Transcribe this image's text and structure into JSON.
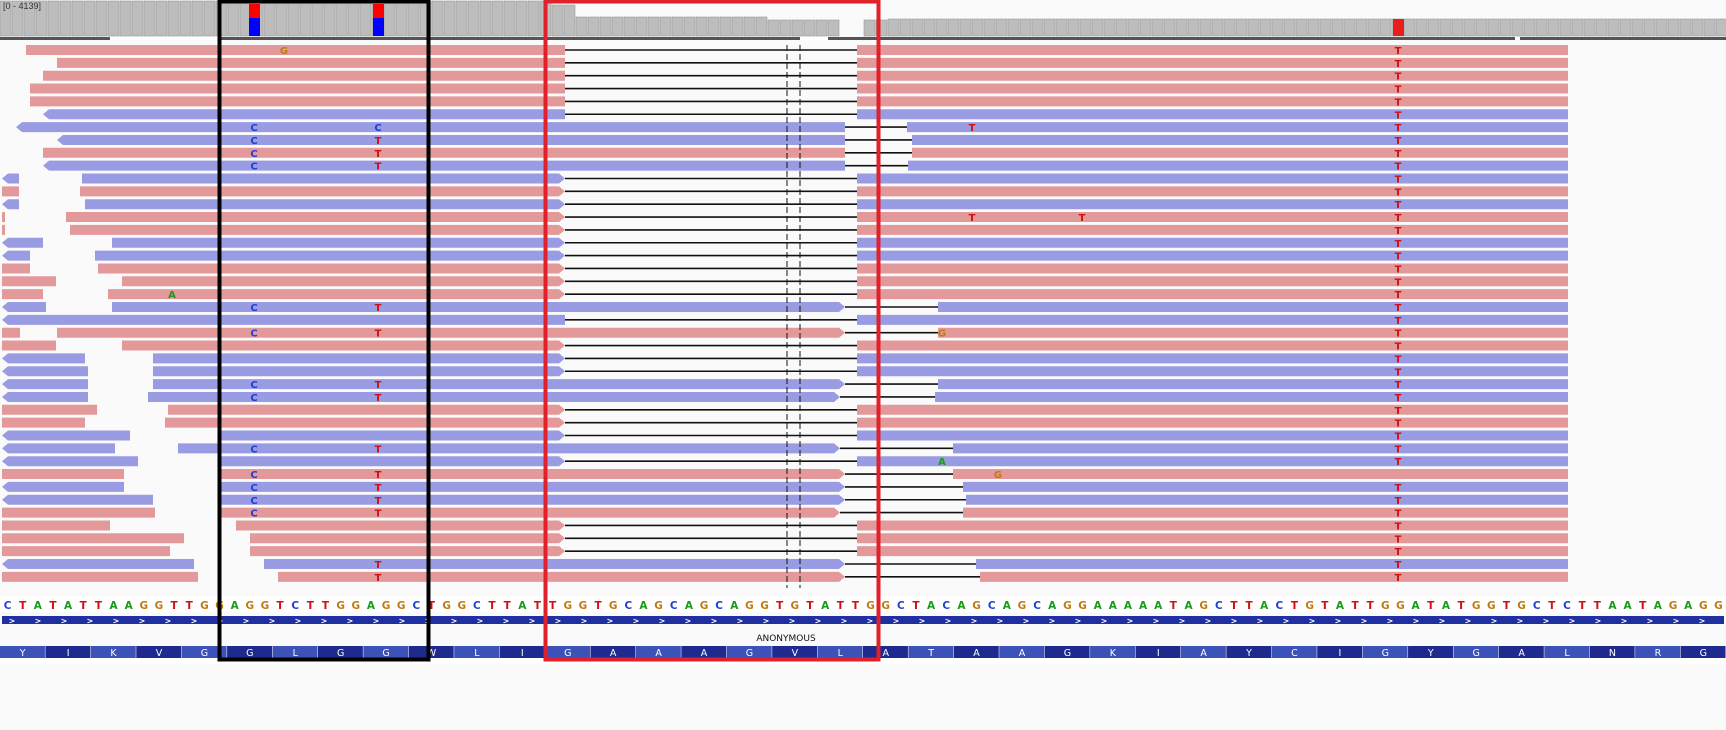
{
  "coverage": {
    "range_label": "[0 - 4139]",
    "mismatch_colors": {
      "top": "#ff0000",
      "bottom": "#0000ff"
    }
  },
  "colors": {
    "forward_read": "#e3999a",
    "reverse_read": "#999be3",
    "coverage_bar": "#bdbdbd",
    "highlight_black": "#000000",
    "highlight_red": "#e0202a"
  },
  "reads": {
    "rows": [
      {
        "strand": "+",
        "segments": [
          [
            26,
            565
          ],
          [
            857,
            1568
          ]
        ],
        "mismatches": [
          {
            "pos": 284,
            "base": "G"
          },
          {
            "pos": 1398,
            "base": "T"
          }
        ]
      },
      {
        "strand": "+",
        "segments": [
          [
            57,
            565
          ],
          [
            857,
            1568
          ]
        ],
        "mismatches": [
          {
            "pos": 1398,
            "base": "T"
          }
        ]
      },
      {
        "strand": "+",
        "segments": [
          [
            43,
            565
          ],
          [
            857,
            1568
          ]
        ],
        "mismatches": [
          {
            "pos": 1398,
            "base": "T"
          }
        ]
      },
      {
        "strand": "+",
        "segments": [
          [
            30,
            565
          ],
          [
            857,
            1568
          ]
        ],
        "mismatches": [
          {
            "pos": 1398,
            "base": "T"
          }
        ]
      },
      {
        "strand": "+",
        "segments": [
          [
            30,
            565
          ],
          [
            857,
            1568
          ]
        ],
        "mismatches": [
          {
            "pos": 1398,
            "base": "T"
          }
        ]
      },
      {
        "strand": "-",
        "segments": [
          [
            43,
            565
          ],
          [
            857,
            1568
          ]
        ],
        "mismatches": [
          {
            "pos": 1398,
            "base": "T"
          }
        ]
      },
      {
        "strand": "-",
        "segments": [
          [
            16,
            845
          ],
          [
            907,
            1568
          ]
        ],
        "mismatches": [
          {
            "pos": 254,
            "base": "C"
          },
          {
            "pos": 378,
            "base": "C"
          },
          {
            "pos": 972,
            "base": "T"
          },
          {
            "pos": 1398,
            "base": "T"
          }
        ]
      },
      {
        "strand": "-",
        "segments": [
          [
            57,
            845
          ],
          [
            912,
            1568
          ]
        ],
        "mismatches": [
          {
            "pos": 254,
            "base": "C"
          },
          {
            "pos": 378,
            "base": "T"
          },
          {
            "pos": 1398,
            "base": "T"
          }
        ]
      },
      {
        "strand": "+",
        "segments": [
          [
            43,
            845
          ],
          [
            912,
            1568
          ]
        ],
        "mismatches": [
          {
            "pos": 254,
            "base": "C"
          },
          {
            "pos": 378,
            "base": "T"
          },
          {
            "pos": 1398,
            "base": "T"
          }
        ]
      },
      {
        "strand": "-",
        "segments": [
          [
            43,
            845
          ],
          [
            908,
            1568
          ]
        ],
        "mismatches": [
          {
            "pos": 254,
            "base": "C"
          },
          {
            "pos": 378,
            "base": "T"
          },
          {
            "pos": 1398,
            "base": "T"
          }
        ]
      },
      {
        "strand": "-",
        "segments": [
          [
            2,
            19
          ],
          [
            82,
            565
          ],
          [
            857,
            1568
          ]
        ],
        "mismatches": [
          {
            "pos": 1398,
            "base": "T"
          }
        ]
      },
      {
        "strand": "+",
        "segments": [
          [
            2,
            19
          ],
          [
            80,
            565
          ],
          [
            857,
            1568
          ]
        ],
        "mismatches": [
          {
            "pos": 1398,
            "base": "T"
          }
        ]
      },
      {
        "strand": "-",
        "segments": [
          [
            2,
            19
          ],
          [
            85,
            565
          ],
          [
            857,
            1568
          ]
        ],
        "mismatches": [
          {
            "pos": 1398,
            "base": "T"
          }
        ]
      },
      {
        "strand": "+",
        "segments": [
          [
            2,
            5
          ],
          [
            66,
            565
          ],
          [
            857,
            1568
          ]
        ],
        "mismatches": [
          {
            "pos": 972,
            "base": "T"
          },
          {
            "pos": 1082,
            "base": "T"
          },
          {
            "pos": 1398,
            "base": "T"
          }
        ]
      },
      {
        "strand": "+",
        "segments": [
          [
            2,
            5
          ],
          [
            70,
            565
          ],
          [
            857,
            1568
          ]
        ],
        "mismatches": [
          {
            "pos": 1398,
            "base": "T"
          }
        ]
      },
      {
        "strand": "-",
        "segments": [
          [
            2,
            43
          ],
          [
            112,
            565
          ],
          [
            857,
            1568
          ]
        ],
        "mismatches": [
          {
            "pos": 1398,
            "base": "T"
          }
        ]
      },
      {
        "strand": "-",
        "segments": [
          [
            2,
            30
          ],
          [
            95,
            565
          ],
          [
            857,
            1568
          ]
        ],
        "mismatches": [
          {
            "pos": 1398,
            "base": "T"
          }
        ]
      },
      {
        "strand": "+",
        "segments": [
          [
            2,
            30
          ],
          [
            98,
            565
          ],
          [
            857,
            1568
          ]
        ],
        "mismatches": [
          {
            "pos": 1398,
            "base": "T"
          }
        ]
      },
      {
        "strand": "+",
        "segments": [
          [
            2,
            56
          ],
          [
            122,
            565
          ],
          [
            857,
            1568
          ]
        ],
        "mismatches": [
          {
            "pos": 1398,
            "base": "T"
          }
        ]
      },
      {
        "strand": "+",
        "segments": [
          [
            2,
            43
          ],
          [
            108,
            565
          ],
          [
            857,
            1568
          ]
        ],
        "mismatches": [
          {
            "pos": 172,
            "base": "A"
          },
          {
            "pos": 1398,
            "base": "T"
          }
        ]
      },
      {
        "strand": "-",
        "segments": [
          [
            2,
            46
          ],
          [
            112,
            845
          ],
          [
            938,
            1568
          ]
        ],
        "mismatches": [
          {
            "pos": 254,
            "base": "C"
          },
          {
            "pos": 378,
            "base": "T"
          },
          {
            "pos": 1398,
            "base": "T"
          }
        ]
      },
      {
        "strand": "-",
        "segments": [
          [
            2,
            565
          ],
          [
            857,
            1568
          ]
        ],
        "mismatches": [
          {
            "pos": 1398,
            "base": "T"
          }
        ]
      },
      {
        "strand": "+",
        "segments": [
          [
            2,
            20
          ],
          [
            57,
            845
          ],
          [
            938,
            1568
          ]
        ],
        "mismatches": [
          {
            "pos": 254,
            "base": "C"
          },
          {
            "pos": 378,
            "base": "T"
          },
          {
            "pos": 942,
            "base": "G"
          },
          {
            "pos": 1398,
            "base": "T"
          }
        ]
      },
      {
        "strand": "+",
        "segments": [
          [
            2,
            56
          ],
          [
            122,
            565
          ],
          [
            857,
            1568
          ]
        ],
        "mismatches": [
          {
            "pos": 1398,
            "base": "T"
          }
        ]
      },
      {
        "strand": "-",
        "segments": [
          [
            2,
            85
          ],
          [
            153,
            565
          ],
          [
            857,
            1568
          ]
        ],
        "mismatches": [
          {
            "pos": 1398,
            "base": "T"
          }
        ]
      },
      {
        "strand": "-",
        "segments": [
          [
            2,
            88
          ],
          [
            153,
            565
          ],
          [
            857,
            1568
          ]
        ],
        "mismatches": [
          {
            "pos": 1398,
            "base": "T"
          }
        ]
      },
      {
        "strand": "-",
        "segments": [
          [
            2,
            88
          ],
          [
            153,
            845
          ],
          [
            938,
            1568
          ]
        ],
        "mismatches": [
          {
            "pos": 254,
            "base": "C"
          },
          {
            "pos": 378,
            "base": "T"
          },
          {
            "pos": 1398,
            "base": "T"
          }
        ]
      },
      {
        "strand": "-",
        "segments": [
          [
            2,
            88
          ],
          [
            148,
            840
          ],
          [
            935,
            1568
          ]
        ],
        "mismatches": [
          {
            "pos": 254,
            "base": "C"
          },
          {
            "pos": 378,
            "base": "T"
          },
          {
            "pos": 1398,
            "base": "T"
          }
        ]
      },
      {
        "strand": "+",
        "segments": [
          [
            2,
            97
          ],
          [
            168,
            565
          ],
          [
            857,
            1568
          ]
        ],
        "mismatches": [
          {
            "pos": 1398,
            "base": "T"
          }
        ]
      },
      {
        "strand": "+",
        "segments": [
          [
            2,
            85
          ],
          [
            165,
            565
          ],
          [
            857,
            1568
          ]
        ],
        "mismatches": [
          {
            "pos": 1398,
            "base": "T"
          }
        ]
      },
      {
        "strand": "-",
        "segments": [
          [
            2,
            130
          ],
          [
            218,
            565
          ],
          [
            857,
            1568
          ]
        ],
        "mismatches": [
          {
            "pos": 1398,
            "base": "T"
          }
        ]
      },
      {
        "strand": "-",
        "segments": [
          [
            2,
            115
          ],
          [
            178,
            840
          ],
          [
            953,
            1568
          ]
        ],
        "mismatches": [
          {
            "pos": 254,
            "base": "C"
          },
          {
            "pos": 378,
            "base": "T"
          },
          {
            "pos": 1398,
            "base": "T"
          }
        ]
      },
      {
        "strand": "-",
        "segments": [
          [
            2,
            138
          ],
          [
            218,
            565
          ],
          [
            857,
            1568
          ]
        ],
        "mismatches": [
          {
            "pos": 942,
            "base": "A"
          },
          {
            "pos": 1398,
            "base": "T"
          }
        ]
      },
      {
        "strand": "+",
        "segments": [
          [
            2,
            124
          ],
          [
            220,
            845
          ],
          [
            953,
            1568
          ]
        ],
        "mismatches": [
          {
            "pos": 254,
            "base": "C"
          },
          {
            "pos": 378,
            "base": "T"
          },
          {
            "pos": 998,
            "base": "G"
          }
        ]
      },
      {
        "strand": "-",
        "segments": [
          [
            2,
            124
          ],
          [
            220,
            845
          ],
          [
            963,
            1568
          ]
        ],
        "mismatches": [
          {
            "pos": 254,
            "base": "C"
          },
          {
            "pos": 378,
            "base": "T"
          },
          {
            "pos": 1398,
            "base": "T"
          }
        ]
      },
      {
        "strand": "-",
        "segments": [
          [
            2,
            153
          ],
          [
            220,
            845
          ],
          [
            966,
            1568
          ]
        ],
        "mismatches": [
          {
            "pos": 254,
            "base": "C"
          },
          {
            "pos": 378,
            "base": "T"
          },
          {
            "pos": 1398,
            "base": "T"
          }
        ]
      },
      {
        "strand": "+",
        "segments": [
          [
            2,
            155
          ],
          [
            220,
            840
          ],
          [
            963,
            1568
          ]
        ],
        "mismatches": [
          {
            "pos": 254,
            "base": "C"
          },
          {
            "pos": 378,
            "base": "T"
          },
          {
            "pos": 1398,
            "base": "T"
          }
        ]
      },
      {
        "strand": "+",
        "segments": [
          [
            2,
            110
          ],
          [
            236,
            565
          ],
          [
            857,
            1568
          ]
        ],
        "mismatches": [
          {
            "pos": 1398,
            "base": "T"
          }
        ]
      },
      {
        "strand": "+",
        "segments": [
          [
            2,
            184
          ],
          [
            250,
            565
          ],
          [
            857,
            1568
          ]
        ],
        "mismatches": [
          {
            "pos": 1398,
            "base": "T"
          }
        ]
      },
      {
        "strand": "+",
        "segments": [
          [
            2,
            170
          ],
          [
            250,
            565
          ],
          [
            857,
            1568
          ]
        ],
        "mismatches": [
          {
            "pos": 1398,
            "base": "T"
          }
        ]
      },
      {
        "strand": "-",
        "segments": [
          [
            2,
            194
          ],
          [
            264,
            845
          ],
          [
            976,
            1568
          ]
        ],
        "mismatches": [
          {
            "pos": 378,
            "base": "T"
          },
          {
            "pos": 1398,
            "base": "T"
          }
        ]
      },
      {
        "strand": "+",
        "segments": [
          [
            2,
            198
          ],
          [
            278,
            845
          ],
          [
            980,
            1568
          ]
        ],
        "mismatches": [
          {
            "pos": 378,
            "base": "T"
          },
          {
            "pos": 1398,
            "base": "T"
          }
        ]
      }
    ]
  },
  "sequence": {
    "bases": "CTATATTAAGGTTGGAGGTCTTGGAGGCTGGCTTATTGGTGCAGCAGCAGGTGTATTGGCTACAGCAGCAGGAAAAATAGCTTACTGTATTGGATATGGTGCTCTTAATAGAGG",
    "base_colors": {
      "A": "#1a9a1a",
      "C": "#1f3fd0",
      "G": "#c07a10",
      "T": "#d01010"
    }
  },
  "feature": {
    "label": "ANONYMOUS"
  },
  "translation": {
    "amino_acids": [
      "Y",
      "I",
      "K",
      "V",
      "G",
      "G",
      "L",
      "G",
      "G",
      "W",
      "L",
      "I",
      "G",
      "A",
      "A",
      "A",
      "G",
      "V",
      "L",
      "A",
      "T",
      "A",
      "A",
      "G",
      "K",
      "I",
      "A",
      "Y",
      "C",
      "I",
      "G",
      "Y",
      "G",
      "A",
      "L",
      "N",
      "R",
      "G"
    ],
    "dark": "#1f2a8f",
    "light": "#3c52b8"
  }
}
